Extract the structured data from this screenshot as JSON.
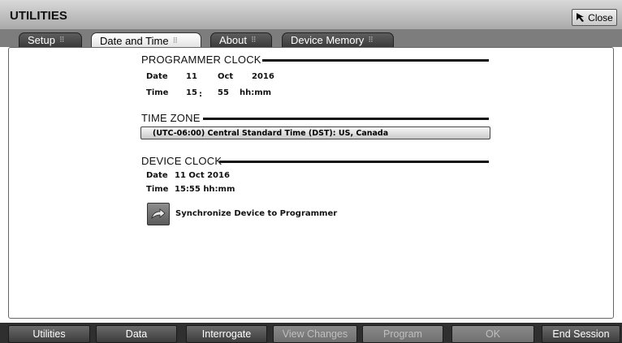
{
  "window": {
    "title": "UTILITIES",
    "close_label": "Close"
  },
  "tabs": [
    {
      "label": "Setup",
      "active": false
    },
    {
      "label": "Date and Time",
      "active": true
    },
    {
      "label": "About",
      "active": false
    },
    {
      "label": "Device Memory",
      "active": false
    }
  ],
  "programmer_clock": {
    "title": "PROGRAMMER CLOCK",
    "date_label": "Date",
    "day": "11",
    "month": "Oct",
    "year": "2016",
    "time_label": "Time",
    "hour": "15",
    "separator": ":",
    "minute": "55",
    "format": "hh:mm"
  },
  "time_zone": {
    "title": "TIME ZONE",
    "selected": "(UTC-06:00) Central Standard Time (DST): US, Canada"
  },
  "device_clock": {
    "title": "DEVICE CLOCK",
    "date_label": "Date",
    "date_value": "11 Oct 2016",
    "time_label": "Time",
    "time_value": "15:55 hh:mm",
    "sync_label": "Synchronize Device to Programmer"
  },
  "bottom_bar": [
    {
      "label": "Utilities",
      "enabled": true
    },
    {
      "label": "Data",
      "enabled": true
    },
    {
      "label": "Interrogate",
      "enabled": true
    },
    {
      "label": "View Changes",
      "enabled": false
    },
    {
      "label": "Program",
      "enabled": false
    },
    {
      "label": "OK",
      "enabled": false
    },
    {
      "label": "End Session",
      "enabled": true
    }
  ]
}
